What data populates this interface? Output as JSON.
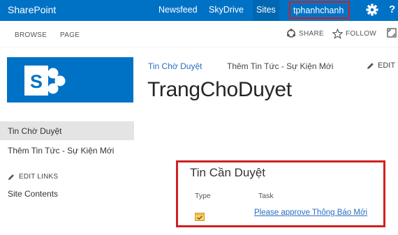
{
  "suite_bar": {
    "brand": "SharePoint",
    "links": [
      "Newsfeed",
      "SkyDrive",
      "Sites"
    ],
    "user": "tphanhchanh",
    "help": "?"
  },
  "ribbon": {
    "tabs": [
      "BROWSE",
      "PAGE"
    ],
    "share": "SHARE",
    "follow": "FOLLOW"
  },
  "top_nav": {
    "items": [
      "Tin Chờ Duyệt",
      "Thêm Tin Tức - Sự Kiện Mới"
    ],
    "edit": "EDIT"
  },
  "page_title": "TrangChoDuyet",
  "left_nav": {
    "items": [
      "Tin Chờ Duyệt",
      "Thêm Tin Tức - Sự Kiện Mới"
    ],
    "edit_links": "EDIT LINKS",
    "site_contents": "Site Contents"
  },
  "tasks_part": {
    "title": "Tin Cần Duyệt",
    "columns": [
      "Type",
      "Task"
    ],
    "rows": [
      {
        "type_icon": "task-icon",
        "task": "Please approve Thông Báo Mới"
      }
    ]
  },
  "colors": {
    "suite_bar": "#0072c6",
    "highlight_border": "#d02020",
    "link": "#2a6ec1"
  }
}
